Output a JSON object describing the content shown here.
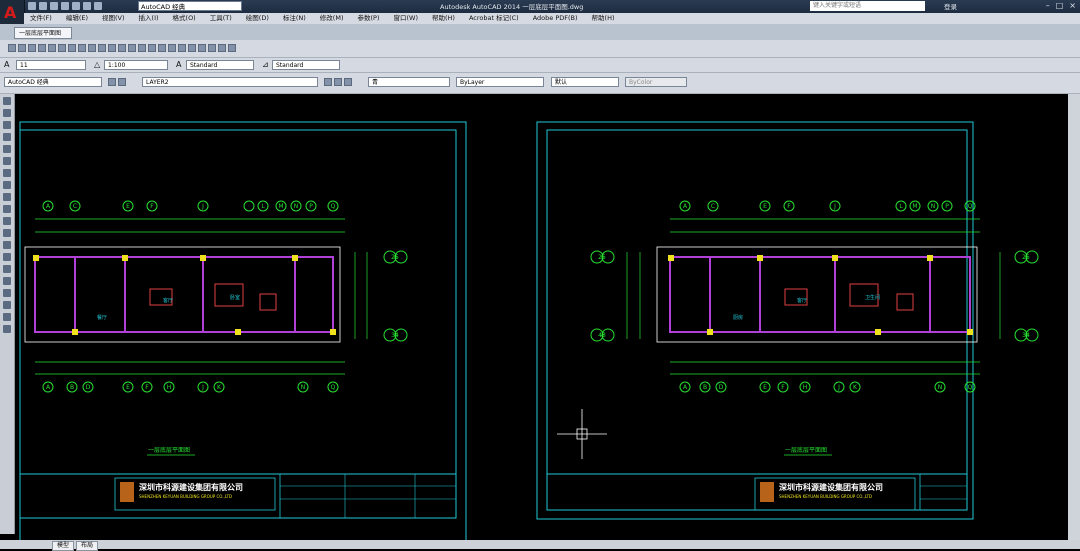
{
  "window": {
    "title": "Autodesk AutoCAD 2014    一层底层平面图.dwg",
    "workspace": "AutoCAD 经典",
    "search_placeholder": "键入关键字或短语",
    "login": "登录"
  },
  "menu": [
    "文件(F)",
    "编辑(E)",
    "视图(V)",
    "插入(I)",
    "格式(O)",
    "工具(T)",
    "绘图(D)",
    "标注(N)",
    "修改(M)",
    "参数(P)",
    "窗口(W)",
    "帮助(H)",
    "Acrobat 标记(C)",
    "Adobe PDF(B)",
    "帮助(H)"
  ],
  "doc_tab": "一层底层平面图",
  "styles": {
    "text_height": "11",
    "scale": "1:100",
    "text_style": "Standard",
    "dim_style": "Standard"
  },
  "layers": {
    "workspace_combo": "AutoCAD 经典",
    "current_layer": "LAYER2",
    "color": "青",
    "linetype": "ByLayer",
    "lineweight": "默认",
    "plotstyle": "ByColor"
  },
  "drawing": {
    "company": "深圳市科源建设集团有限公司",
    "company_en": "SHENZHEN KEYUAN BUILDING GROUP CO.,LTD",
    "plan_title": "一层底层平面图",
    "axes_top": [
      "A",
      "C",
      "E",
      "F",
      "J",
      "L",
      "M",
      "N",
      "P",
      "Q"
    ],
    "axes_bottom": [
      "A",
      "B",
      "D",
      "E",
      "F",
      "H",
      "J",
      "K",
      "N",
      "Q"
    ],
    "side_labels_right": [
      "25",
      "34"
    ],
    "side_labels_left": [
      "25",
      "43"
    ],
    "room_labels": [
      "客厅",
      "餐厅",
      "厨房",
      "卧室",
      "卫生间"
    ]
  },
  "bottom_tabs": [
    "模型",
    "布局"
  ],
  "colors": {
    "frame": "#21c7d6",
    "grid": "#27e032",
    "walls": "#b040d8",
    "title_yellow": "#f0e21c"
  }
}
